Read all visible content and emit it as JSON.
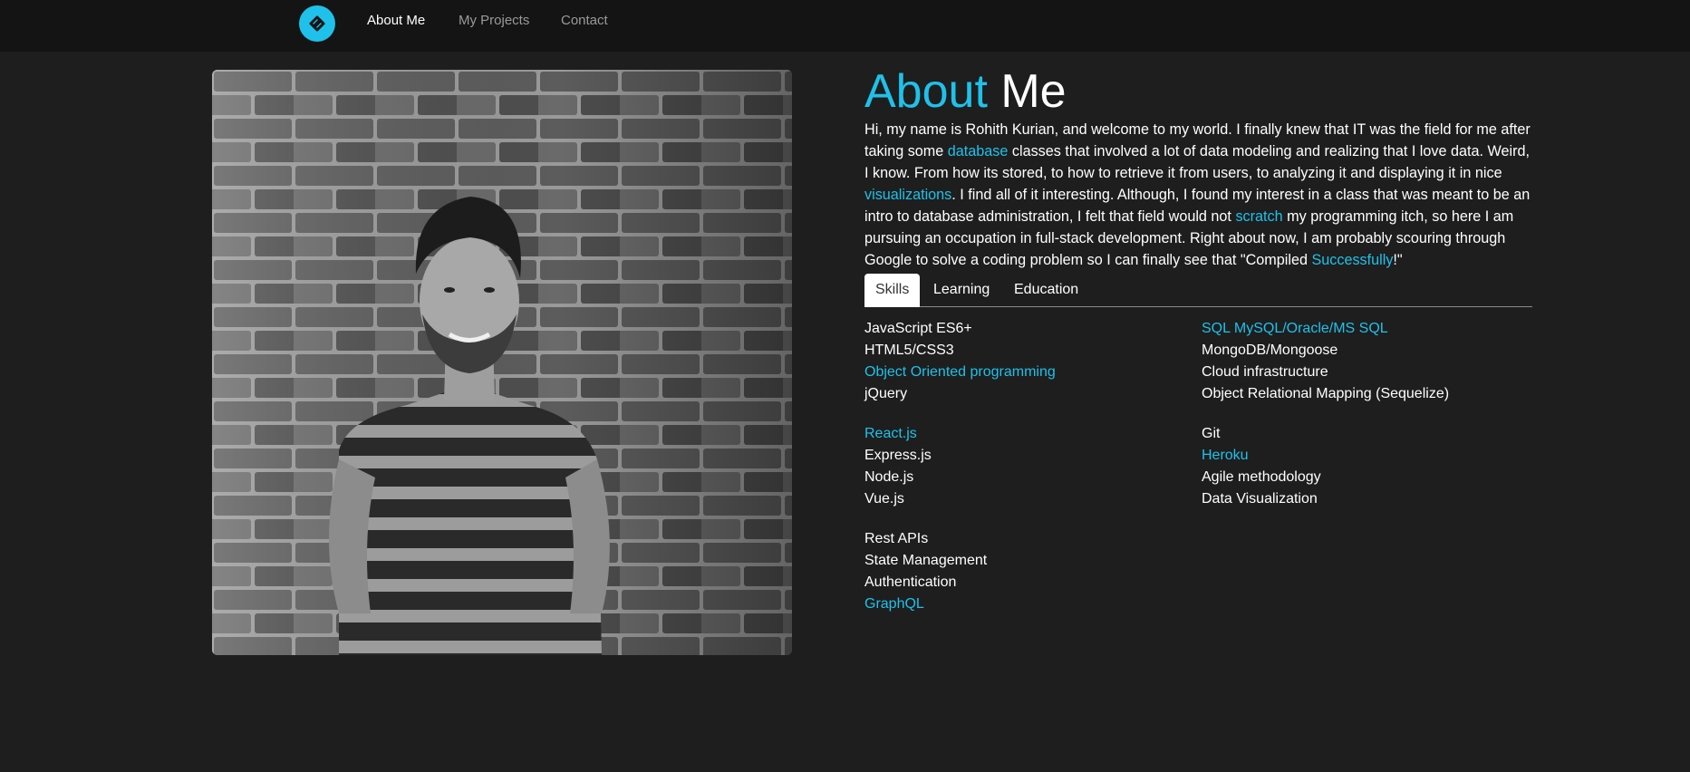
{
  "nav": {
    "logo_icon": "circle-link-logo-icon",
    "links": [
      "About Me",
      "My Projects",
      "Contact"
    ]
  },
  "photo": {
    "description_icon": "profile-photo"
  },
  "about": {
    "title_accent": "About",
    "title_rest": " Me",
    "intro": {
      "p1": "Hi, my name is Rohith Kurian, and welcome to my world. I finally knew that IT was the field for me after taking some ",
      "l1": "database",
      "p2": " classes that involved a lot of data modeling and realizing that I love data. Weird, I know. From how its stored, to how to retrieve it from users, to analyzing it and displaying it in nice ",
      "l2": "visualizations",
      "p3": ". I find all of it interesting. Although, I found my interest in a class that was meant to be an intro to database administration, I felt that field would not ",
      "l3": "scratch",
      "p4": " my programming itch, so here I am pursuing an occupation in full-stack development. Right about now, I am probably scouring through Google to solve a coding problem so I can finally see that \"Compiled ",
      "l4": "Successfully",
      "p5": "!\""
    }
  },
  "tabs": [
    "Skills",
    "Learning",
    "Education"
  ],
  "skills": {
    "left": [
      [
        "JavaScript ES6+",
        "HTML5/CSS3",
        "Object Oriented programming",
        "jQuery"
      ],
      [
        "React.js",
        "Express.js",
        "Node.js",
        "Vue.js"
      ],
      [
        "Rest APIs",
        "State Management",
        "Authentication",
        "GraphQL"
      ]
    ],
    "right": [
      [
        "SQL MySQL/Oracle/MS SQL",
        "MongoDB/Mongoose",
        "Cloud infrastructure",
        "Object Relational Mapping (Sequelize)"
      ],
      [
        "Git",
        "Heroku",
        "Agile methodology",
        "Data Visualization"
      ]
    ]
  },
  "colors": {
    "accent": "#1fc1ea",
    "background": "#1e1e1e",
    "navbar": "#141414"
  }
}
